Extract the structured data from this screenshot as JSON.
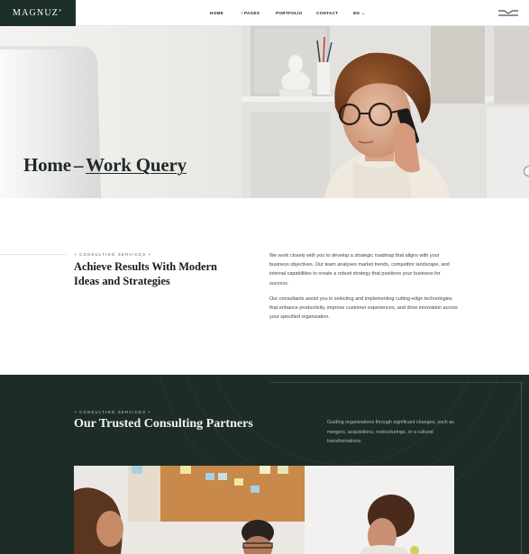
{
  "header": {
    "logo": "MAGNUZ",
    "logo_mark": "®",
    "nav": {
      "home": "HOME",
      "pages_prefix": "+",
      "pages": "PAGES",
      "portfolio": "PORTFOLIO",
      "contact": "CONTACT",
      "language": "EN",
      "language_caret": "⌄"
    },
    "menu_icon": "hamburger-menu-icon"
  },
  "hero": {
    "breadcrumb_home": "Home",
    "separator": "–",
    "breadcrumb_current": "Work Query"
  },
  "about": {
    "eyebrow": "• CONSULTING SERVICES •",
    "heading": "Achieve Results With Modern Ideas and Strategies",
    "paragraph1": "We work closely with you to develop a strategic roadmap that aligns with your business objectives. Our team analyses market trends, competitor landscape, and internal capabilities to create a robust strategy that positions your business for success.",
    "paragraph2": "Our consultants assist you in selecting and implementing cutting-edge technologies that enhance productivity, improve customer experiences, and drive innovation across your specified organization."
  },
  "partners": {
    "eyebrow": "• CONSULTING SERVICES •",
    "heading": "Our Trusted Consulting Partners",
    "paragraph": "Guiding organizations through significant changes, such as mergers, acquisitions, restructurings, or a cultural transformations."
  },
  "colors": {
    "brand_dark_green": "#1d3027",
    "section_dark": "#1d2c26",
    "text_dark": "#1e1e1e"
  }
}
